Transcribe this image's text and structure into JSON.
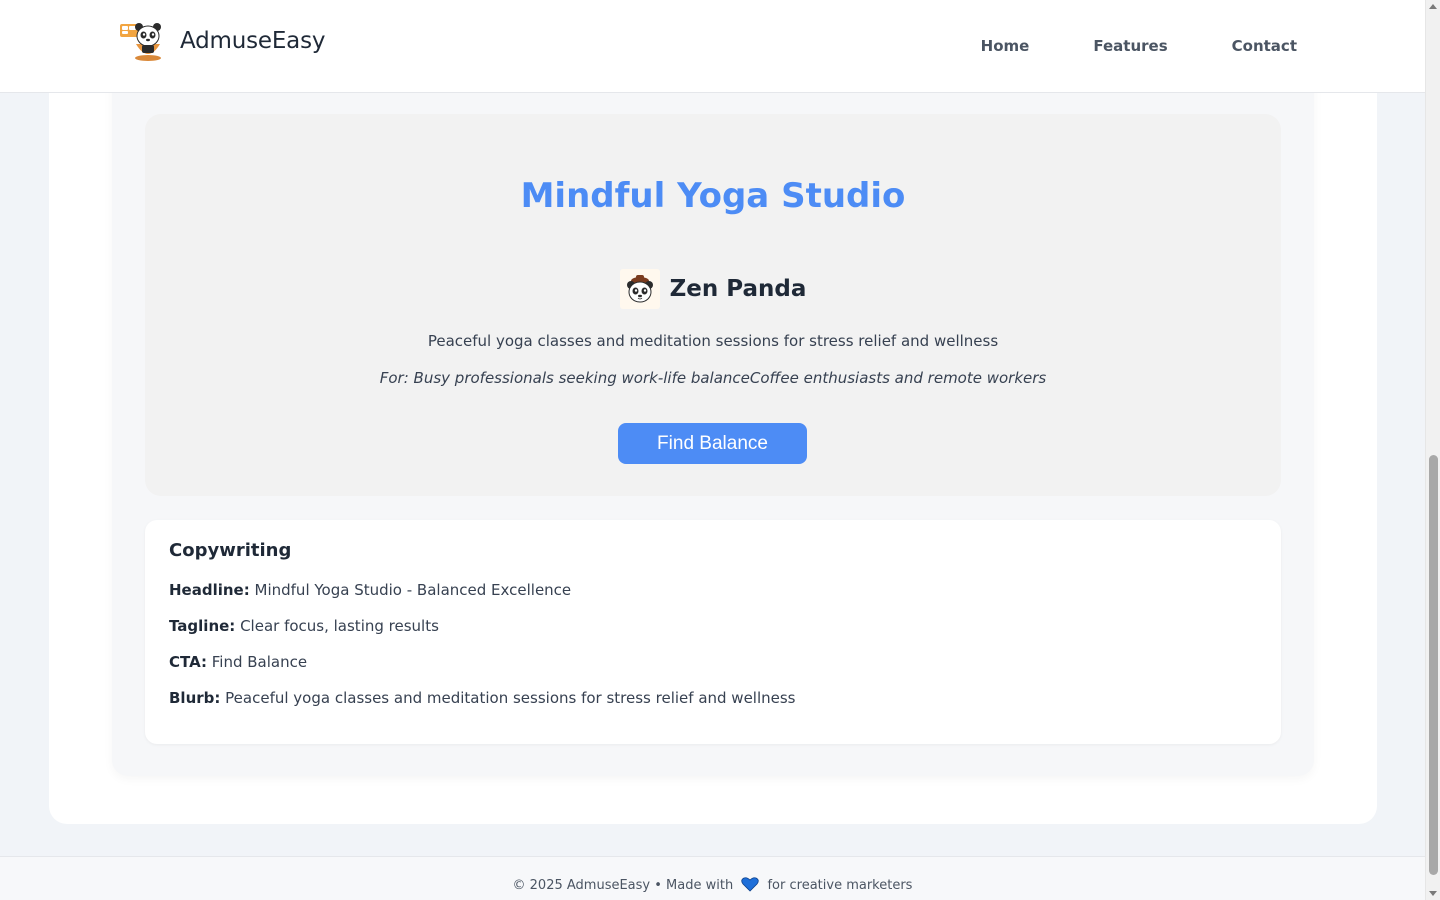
{
  "header": {
    "brand": "AdmuseEasy",
    "logo_icon": "panda-mascot-icon",
    "nav": [
      {
        "label": "Home"
      },
      {
        "label": "Features"
      },
      {
        "label": "Contact"
      }
    ]
  },
  "ad_preview": {
    "title": "Mindful Yoga Studio",
    "mascot_icon": "panda-icon",
    "mascot_name": "Zen Panda",
    "description": "Peaceful yoga classes and meditation sessions for stress relief and wellness",
    "audience": "For: Busy professionals seeking work-life balanceCoffee enthusiasts and remote workers",
    "cta_label": "Find Balance"
  },
  "copywriting": {
    "heading": "Copywriting",
    "items": [
      {
        "label": "Headline:",
        "value": "Mindful Yoga Studio - Balanced Excellence"
      },
      {
        "label": "Tagline:",
        "value": "Clear focus, lasting results"
      },
      {
        "label": "CTA:",
        "value": "Find Balance"
      },
      {
        "label": "Blurb:",
        "value": "Peaceful yoga classes and meditation sessions for stress relief and wellness"
      }
    ]
  },
  "footer": {
    "text_before": "© 2025 AdmuseEasy • Made with",
    "heart_icon": "heart-icon",
    "text_after": "for creative marketers"
  },
  "colors": {
    "accent": "#4d8cf5",
    "heart": "#1e6fd9"
  }
}
